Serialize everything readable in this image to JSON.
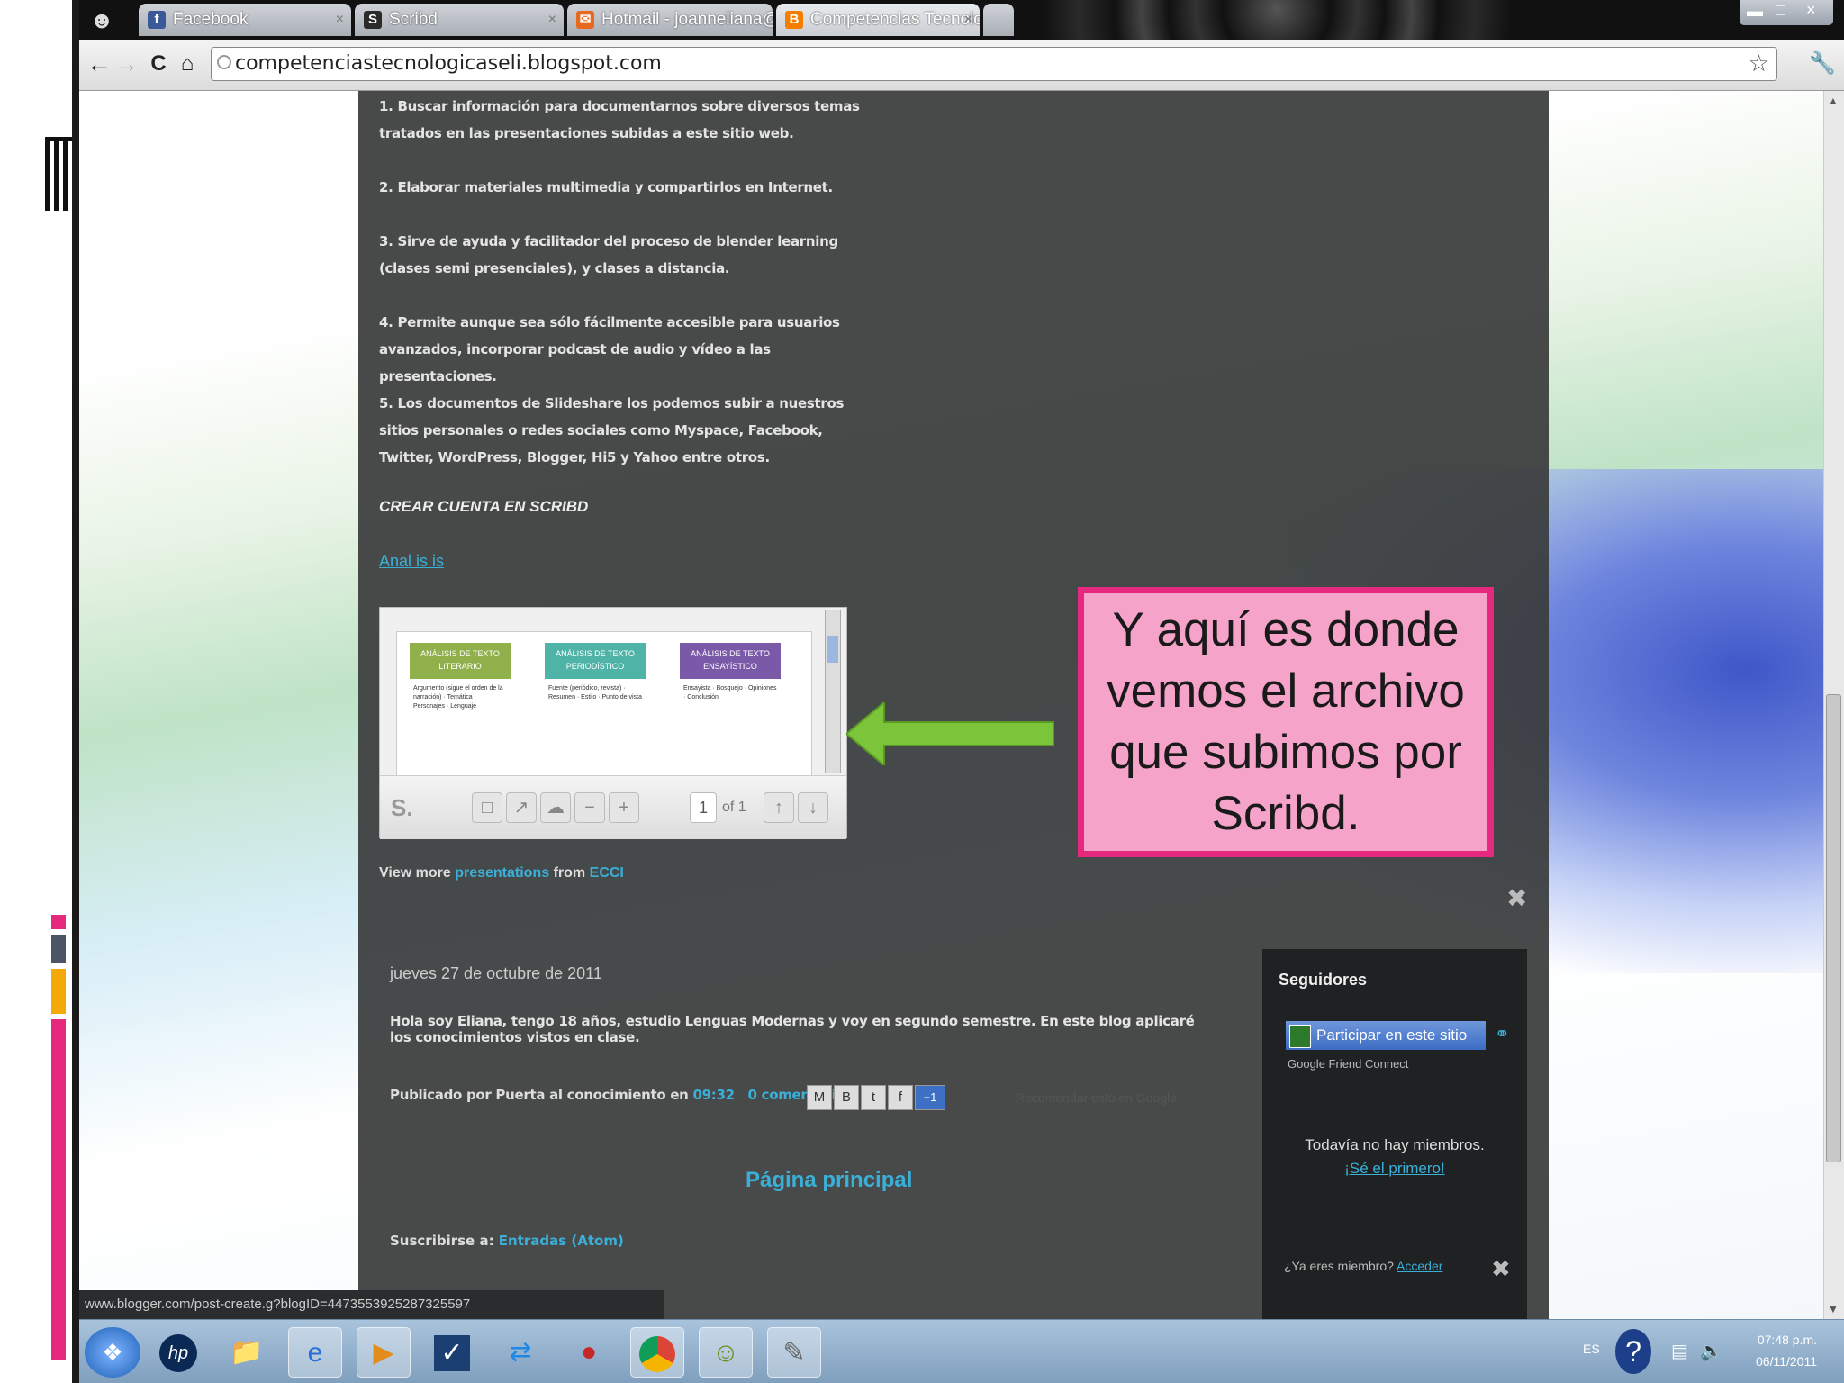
{
  "browser": {
    "tabs": [
      {
        "label": "Facebook",
        "icon": "facebook-icon",
        "color": "#3b5998"
      },
      {
        "label": "Scribd",
        "icon": "scribd-icon",
        "color": "#2b2b2b"
      },
      {
        "label": "Hotmail - joanneliana@hot",
        "icon": "hotmail-icon",
        "color": "#e86a1f"
      },
      {
        "label": "Competencias Tecnologica",
        "icon": "blogger-icon",
        "color": "#f57d00"
      }
    ],
    "url": "competenciastecnologicaseli.blogspot.com"
  },
  "post": {
    "paragraphs": [
      "1. Buscar información para documentarnos sobre diversos temas tratados en las presentaciones subidas a este sitio web.",
      "2. Elaborar materiales multimedia y compartirlos en Internet.",
      "3. Sirve de ayuda y facilitador del proceso de blender learning (clases semi presenciales), y clases a distancia.",
      "4. Permite aunque sea sólo fácilmente accesible para usuarios avanzados, incorporar podcast de audio y vídeo a las presentaciones.",
      "5. Los documentos de Slideshare los podemos subir a nuestros sitios personales o redes sociales como Myspace, Facebook, Twitter, WordPress, Blogger, Hi5 y Yahoo entre otros."
    ],
    "crear_heading": "CREAR CUENTA EN SCRIBD",
    "doc_link": "Anal is is",
    "view_more_prefix": "View more",
    "view_more_link1": "presentations",
    "view_more_mid": "from",
    "view_more_link2": "ECCI"
  },
  "scribd_embed": {
    "cards": [
      {
        "title": "ANÁLISIS DE TEXTO LITERARIO",
        "color": "#8fb04a",
        "body": "Argumento (sigue el orden de la narración) · Temática · Personajes · Lenguaje"
      },
      {
        "title": "ANÁLISIS DE TEXTO PERIODÍSTICO",
        "color": "#4fb3a8",
        "body": "Fuente (periódico, revista) · Resumen · Estilo · Punto de vista"
      },
      {
        "title": "ANÁLISIS DE TEXTO ENSAYÍSTICO",
        "color": "#7a5aa8",
        "body": "Ensayista · Bosquejo · Opiniones · Conclusión"
      }
    ],
    "logo": "S.",
    "page_current": "1",
    "page_total": "of 1"
  },
  "post2": {
    "date": "jueves 27 de octubre de 2011",
    "body": "Hola soy Eliana, tengo 18 años, estudio Lenguas Modernas y voy en segundo semestre. En este blog aplicaré los conocimientos vistos en clase.",
    "footer_prefix": "Publicado por Puerta al conocimiento en",
    "footer_time": "09:32",
    "footer_comments": "0 comentarios",
    "recommend": "Recomendar esto en Google",
    "home_link": "Página principal",
    "subscribe_prefix": "Suscribirse a:",
    "subscribe_link": "Entradas (Atom)"
  },
  "sidebar": {
    "title": "Seguidores",
    "join_button": "Participar en este sitio",
    "gfc_label": "Google Friend Connect",
    "no_members": "Todavía no hay miembros.",
    "be_first": "¡Sé el primero!",
    "member_question": "¿Ya eres miembro?",
    "member_link": "Acceder"
  },
  "status_url": "www.blogger.com/post-create.g?blogID=4473553925287325597",
  "taskbar": {
    "lang": "ES",
    "time": "07:48 p.m.",
    "date": "06/11/2011"
  },
  "callout": {
    "text": "Y aquí es donde vemos el archivo que subimos por Scribd.",
    "fill": "#f5a3c9",
    "border": "#e6287f"
  },
  "arrow_color": "#7cc43a"
}
